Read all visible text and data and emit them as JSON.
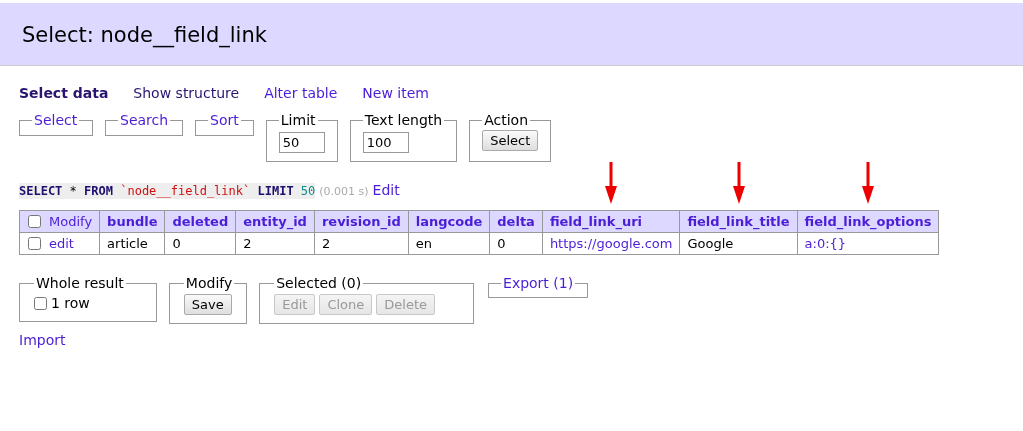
{
  "header": {
    "title": "Select: node__field_link"
  },
  "nav": [
    {
      "label": "Select data",
      "selected": true,
      "visited": false
    },
    {
      "label": "Show structure",
      "selected": false,
      "visited": true
    },
    {
      "label": "Alter table",
      "selected": false,
      "visited": false
    },
    {
      "label": "New item",
      "selected": false,
      "visited": false
    }
  ],
  "fieldsets": [
    {
      "legend": "Select",
      "kind": "link"
    },
    {
      "legend": "Search",
      "kind": "link"
    },
    {
      "legend": "Sort",
      "kind": "link"
    },
    {
      "legend": "Limit",
      "kind": "input",
      "value": "50"
    },
    {
      "legend": "Text length",
      "kind": "input",
      "value": "100"
    },
    {
      "legend": "Action",
      "kind": "button",
      "button": "Select"
    }
  ],
  "query": {
    "tokens": [
      {
        "text": "SELECT",
        "kind": "keyword"
      },
      {
        "text": "*",
        "kind": "op"
      },
      {
        "text": "FROM",
        "kind": "keyword"
      },
      {
        "text": "`node__field_link`",
        "kind": "string"
      },
      {
        "text": "LIMIT",
        "kind": "keyword"
      },
      {
        "text": "50",
        "kind": "number"
      }
    ],
    "time": "(0.001 s)",
    "edit": "Edit"
  },
  "table": {
    "columns": [
      {
        "label": "Modify",
        "kind": "modify",
        "checked": false,
        "marked": false
      },
      {
        "label": "bundle",
        "kind": "column",
        "marked": false
      },
      {
        "label": "deleted",
        "kind": "column",
        "marked": false
      },
      {
        "label": "entity_id",
        "kind": "column",
        "marked": false
      },
      {
        "label": "revision_id",
        "kind": "column",
        "marked": false
      },
      {
        "label": "langcode",
        "kind": "column",
        "marked": false
      },
      {
        "label": "delta",
        "kind": "column",
        "marked": false
      },
      {
        "label": "field_link_uri",
        "kind": "column",
        "marked": true
      },
      {
        "label": "field_link_title",
        "kind": "column",
        "marked": true
      },
      {
        "label": "field_link_options",
        "kind": "column",
        "marked": true
      }
    ],
    "rows": [
      {
        "checked": false,
        "cells": [
          {
            "text": "edit",
            "kind": "modify"
          },
          {
            "text": "article",
            "kind": "text"
          },
          {
            "text": "0",
            "kind": "text"
          },
          {
            "text": "2",
            "kind": "text"
          },
          {
            "text": "2",
            "kind": "text"
          },
          {
            "text": "en",
            "kind": "text"
          },
          {
            "text": "0",
            "kind": "text"
          },
          {
            "text": "https://google.com",
            "kind": "link"
          },
          {
            "text": "Google",
            "kind": "text"
          },
          {
            "text": "a:0:{}",
            "kind": "link"
          }
        ]
      }
    ]
  },
  "bottom": [
    {
      "legend": "Whole result",
      "kind": "checkbox",
      "label": "1 row",
      "checked": false
    },
    {
      "legend": "Modify",
      "kind": "buttons",
      "buttons": [
        {
          "label": "Save",
          "disabled": false
        }
      ]
    },
    {
      "legend": "Selected (0)",
      "kind": "buttons",
      "buttons": [
        {
          "label": "Edit",
          "disabled": true
        },
        {
          "label": "Clone",
          "disabled": true
        },
        {
          "label": "Delete",
          "disabled": true
        }
      ]
    },
    {
      "legend": "Export (1)",
      "kind": "link"
    }
  ],
  "import": "Import"
}
